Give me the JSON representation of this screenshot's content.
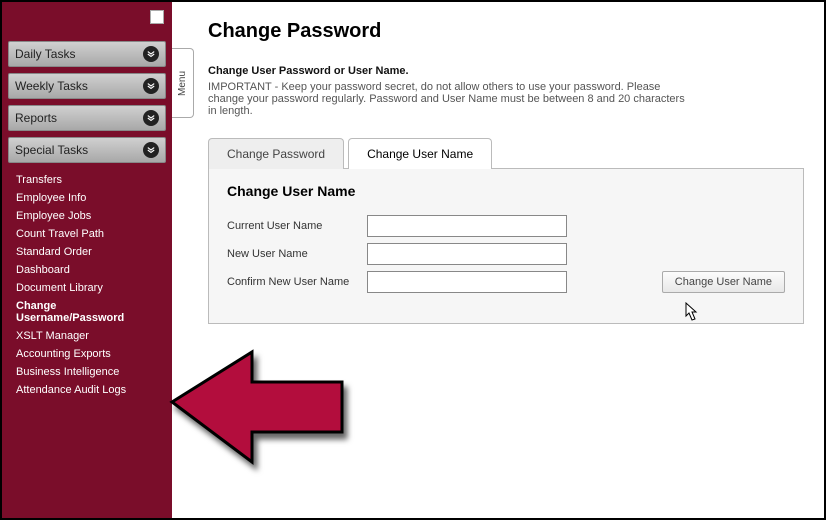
{
  "sidebar": {
    "sections": [
      {
        "label": "Daily Tasks"
      },
      {
        "label": "Weekly Tasks"
      },
      {
        "label": "Reports"
      },
      {
        "label": "Special Tasks"
      }
    ],
    "specialTasks": [
      "Transfers",
      "Employee Info",
      "Employee Jobs",
      "Count Travel Path",
      "Standard Order",
      "Dashboard",
      "Document Library",
      "Change Username/Password",
      "XSLT Manager",
      "Accounting Exports",
      "Business Intelligence",
      "Attendance Audit Logs"
    ]
  },
  "menuHandle": "Menu",
  "page": {
    "title": "Change Password",
    "introTitle": "Change User Password or User Name.",
    "introBody": "IMPORTANT - Keep your password secret, do not allow others to use your password. Please change your password regularly. Password and User Name must be between 8 and 20 characters in length."
  },
  "tabs": {
    "changePassword": "Change Password",
    "changeUserName": "Change User Name"
  },
  "panel": {
    "heading": "Change User Name",
    "fields": {
      "current": "Current User Name",
      "new": "New User Name",
      "confirm": "Confirm New User Name"
    },
    "submit": "Change User Name"
  }
}
